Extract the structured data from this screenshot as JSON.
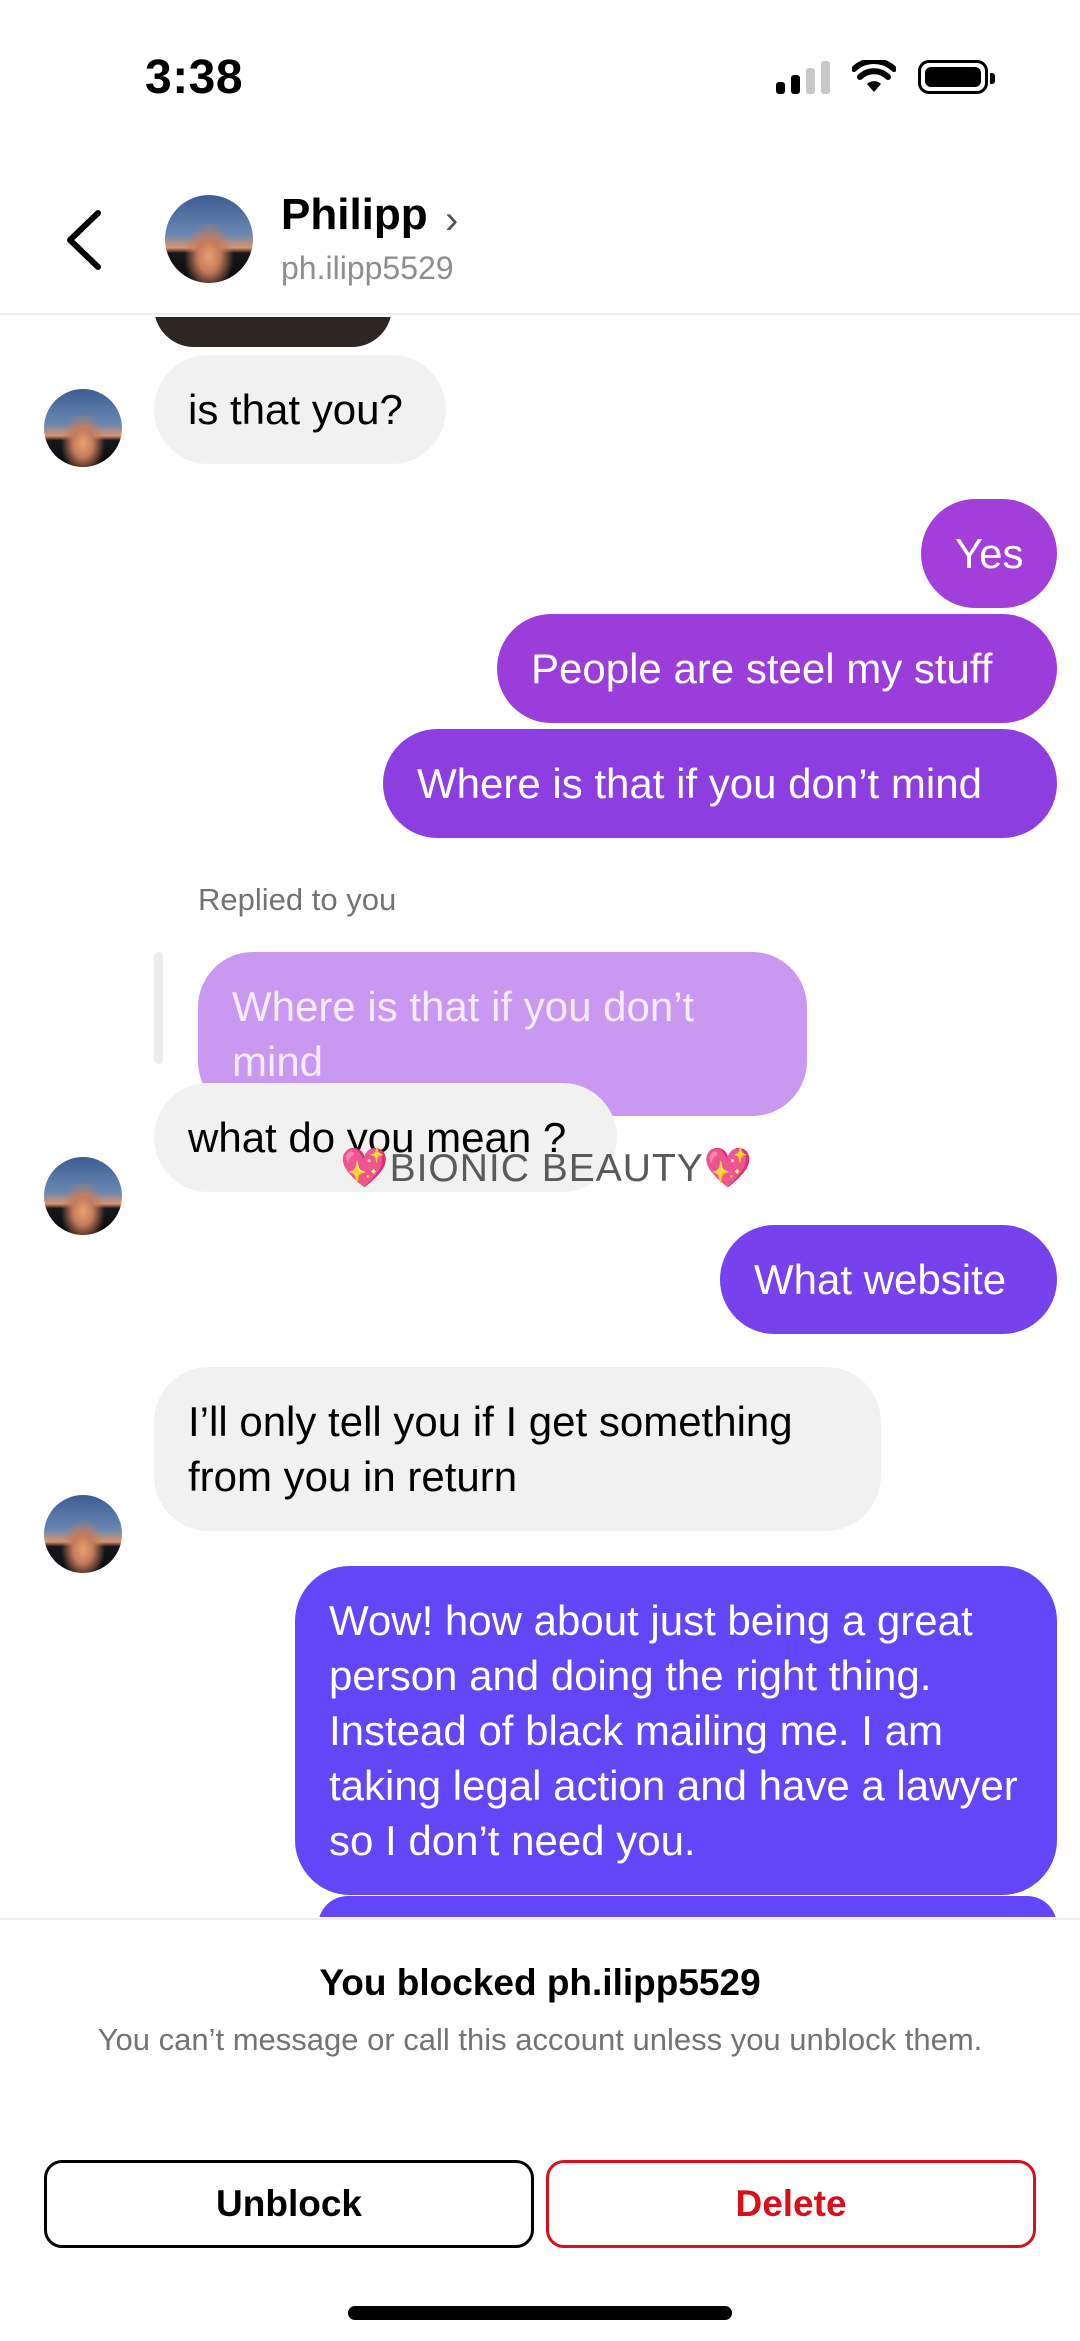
{
  "status_bar": {
    "time": "3:38"
  },
  "header": {
    "name": "Philipp",
    "chevron": "›",
    "username": "ph.ilipp5529"
  },
  "messages": [
    {
      "from": "them",
      "text": "is that you?"
    },
    {
      "from": "me",
      "text": "Yes"
    },
    {
      "from": "me",
      "text": "People are steel my stuff"
    },
    {
      "from": "me",
      "text": "Where is that if you don’t mind"
    },
    {
      "from": "them",
      "reply_label": "Replied to you",
      "quoted": "Where is that if you don’t mind",
      "text": "what do you mean ?"
    },
    {
      "from": "me",
      "text": "What website"
    },
    {
      "from": "them",
      "text": "I’ll only tell you if I get something from you in return"
    },
    {
      "from": "me",
      "text": "Wow! how about just being a great person and doing the right thing. Instead of black mailing me. I am taking legal action and have a lawyer so I don’t need you."
    }
  ],
  "watermark": {
    "text": "BIONIC BEAUTY",
    "heart": "💖"
  },
  "blocked_panel": {
    "title": "You blocked ph.ilipp5529",
    "text": "You can’t message or call this account unless you unblock them.",
    "unblock_label": "Unblock",
    "delete_label": "Delete"
  },
  "colors": {
    "outgoing_top": "#a23ed9",
    "outgoing_bottom": "#6346f7",
    "incoming_bubble": "#f1f1f2",
    "reply_bubble": "#c999f2",
    "delete_red": "#d8101c"
  }
}
